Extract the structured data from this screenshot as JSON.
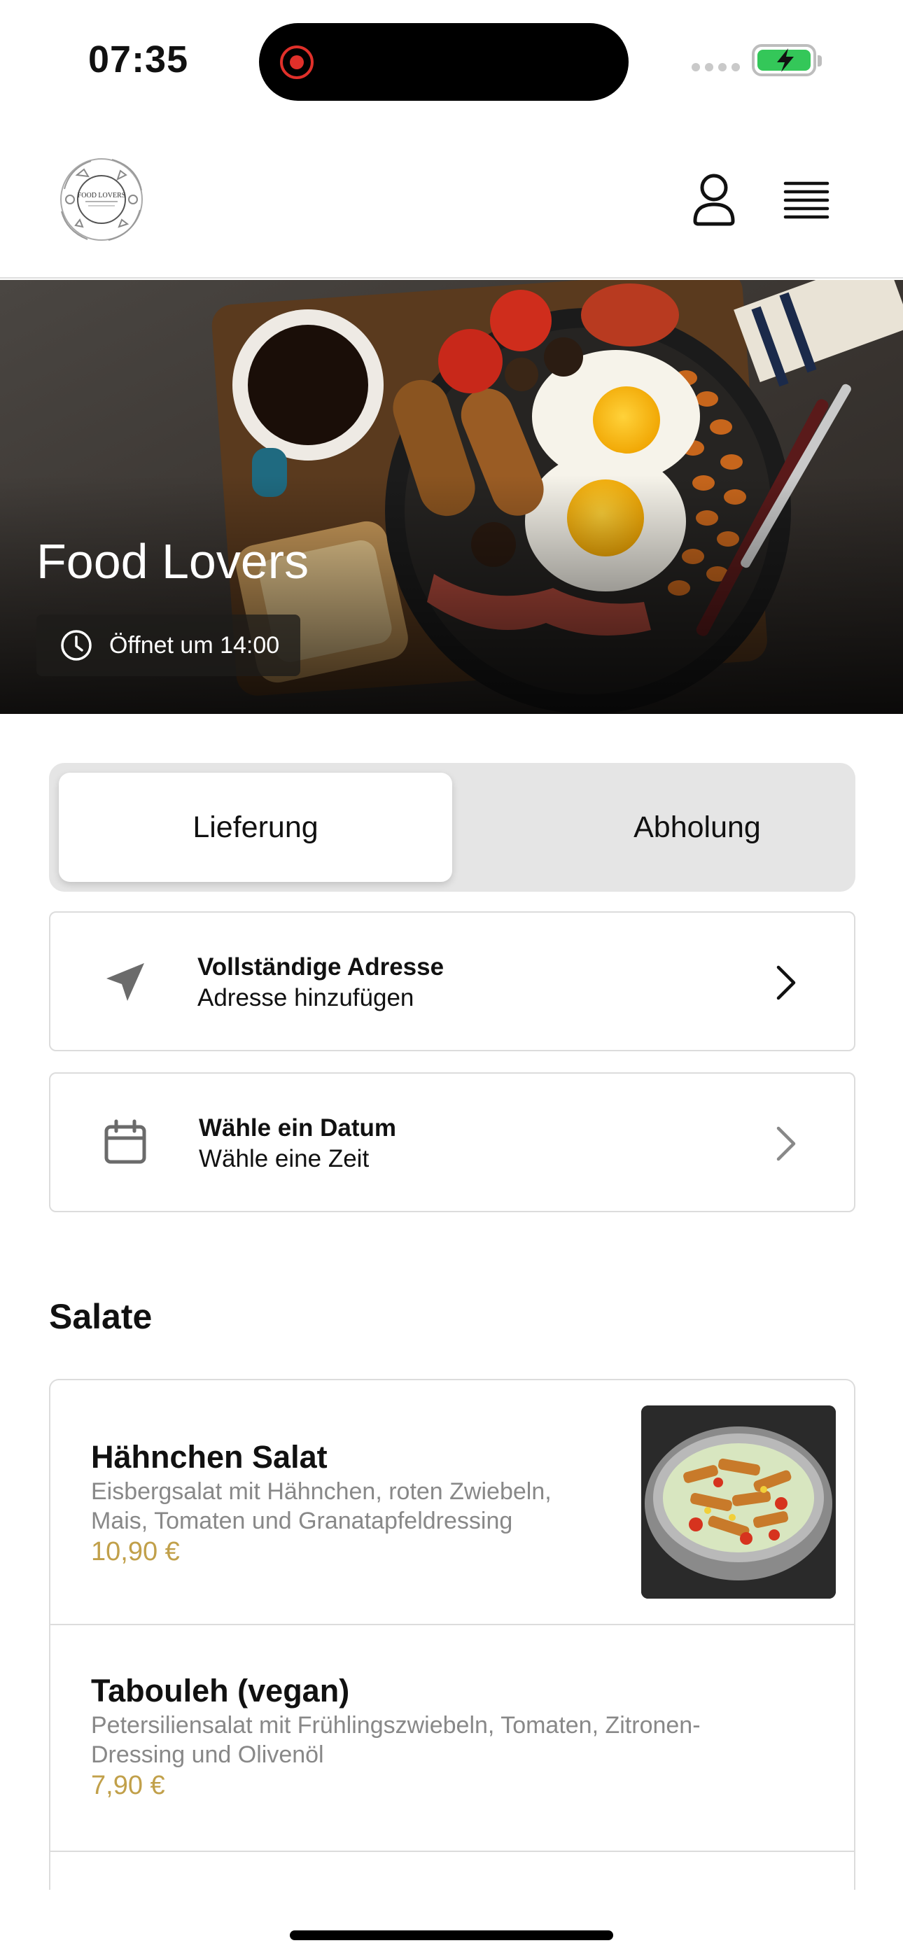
{
  "status_bar": {
    "time": "07:35",
    "recording_indicator": "record-icon",
    "battery_state": "charging",
    "battery_color": "#34c759"
  },
  "header": {
    "logo_text": "FOOD LOVERS",
    "icons": [
      "user-icon",
      "menu-icon"
    ]
  },
  "hero": {
    "title": "Food Lovers",
    "opening_text": "Öffnet um 14:00",
    "clock_icon": "clock-icon"
  },
  "order_mode": {
    "options": [
      "Lieferung",
      "Abholung"
    ],
    "selected": "Lieferung"
  },
  "address_row": {
    "title": "Vollständige Adresse",
    "subtitle": "Adresse hinzufügen",
    "icon": "location-arrow-icon"
  },
  "date_row": {
    "title": "Wähle ein Datum",
    "subtitle": "Wähle eine Zeit",
    "icon": "calendar-icon"
  },
  "section": {
    "title": "Salate"
  },
  "menu_items": [
    {
      "name": "Hähnchen Salat",
      "description_line1": "Eisbergsalat mit Hähnchen, roten Zwiebeln,",
      "description_line2": "Mais, Tomaten und Granatapfeldressing",
      "price": "10,90 €"
    },
    {
      "name": "Tabouleh (vegan)",
      "description_line1": "Petersiliensalat mit Frühlingszwiebeln, Tomaten, Zitronen-",
      "description_line2": "Dressing und Olivenöl",
      "price": "7,90 €"
    }
  ],
  "colors": {
    "accent_price": "#c1a04a",
    "segment_bg": "#e5e5e5",
    "border": "#dcdcdc"
  }
}
